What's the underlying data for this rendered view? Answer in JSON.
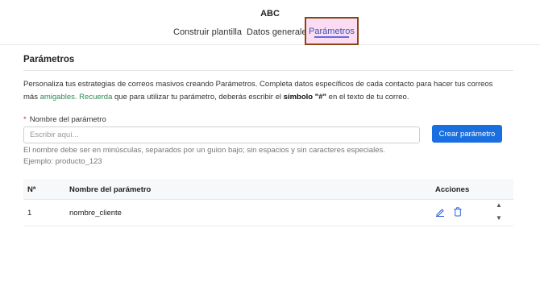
{
  "app": {
    "title": "ABC"
  },
  "tabs": [
    {
      "label": "Construir plantilla"
    },
    {
      "label": "Datos generales"
    },
    {
      "label": "Parámetros"
    }
  ],
  "section": {
    "title": "Parámetros",
    "description": {
      "part1": "Personaliza tus estrategias de correos masivos creando Parámetros. Completa datos específicos de cada contacto para hacer tus correos más ",
      "highlight": "amigables. Recuerda",
      "part2": " que para utilizar tu parámetro, deberás escribir el ",
      "bold": "símbolo \"#\"",
      "part3": " en el texto de tu correo."
    }
  },
  "form": {
    "required_mark": "*",
    "label": "Nombre del parámetro",
    "placeholder": "Escribir aquí...",
    "value": "",
    "create_button": "Crear parámetro",
    "help_line1": "El nombre debe ser en minúsculas, separados por un guion bajo; sin espacios y sin caracteres especiales.",
    "help_line2": "Ejemplo: producto_123"
  },
  "table": {
    "headers": {
      "num": "Nª",
      "name": "Nombre del parámetro",
      "actions": "Acciones"
    },
    "rows": [
      {
        "num": "1",
        "name": "nombre_cliente"
      }
    ]
  },
  "colors": {
    "primary": "#1a6fe0",
    "active_tab_text": "#3b52b4",
    "highlight_text": "#2e8a57",
    "required": "#e0245e",
    "active_tab_border": "#8b4512",
    "active_tab_bg": "#fcdcf2"
  },
  "icons": {
    "edit": "pencil-icon",
    "delete": "trash-icon",
    "scroll_up": "triangle-up-icon",
    "scroll_down": "triangle-down-icon"
  }
}
